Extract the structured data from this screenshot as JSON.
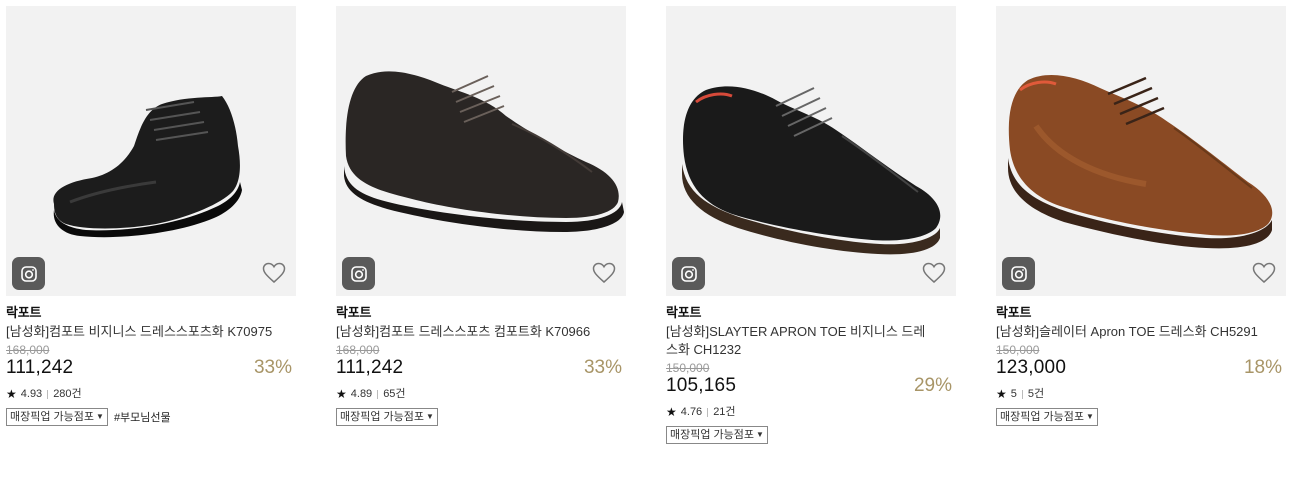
{
  "products": [
    {
      "brand": "락포트",
      "name": "[남성화]컴포트 비지니스 드레스스포츠화 K70975",
      "original_price": "168,000",
      "price": "111,242",
      "discount": "33%",
      "rating": "4.93",
      "reviews": "280건",
      "pickup": "매장픽업 가능점포",
      "hashtag": "#부모님선물",
      "shoe_color": "#1c1c1c",
      "icons": [
        "camera-icon",
        "heart-icon",
        "star-icon",
        "dropdown-arrow-icon"
      ]
    },
    {
      "brand": "락포트",
      "name": "[남성화]컴포트 드레스스포츠 컴포트화 K70966",
      "original_price": "168,000",
      "price": "111,242",
      "discount": "33%",
      "rating": "4.89",
      "reviews": "65건",
      "pickup": "매장픽업 가능점포",
      "shoe_color": "#2a2624",
      "icons": [
        "camera-icon",
        "heart-icon",
        "star-icon",
        "dropdown-arrow-icon"
      ]
    },
    {
      "brand": "락포트",
      "name": "[남성화]SLAYTER APRON TOE 비지니스 드레스화 CH1232",
      "original_price": "150,000",
      "price": "105,165",
      "discount": "29%",
      "rating": "4.76",
      "reviews": "21건",
      "pickup": "매장픽업 가능점포",
      "shoe_color": "#1a1a1a",
      "icons": [
        "camera-icon",
        "heart-icon",
        "star-icon",
        "dropdown-arrow-icon"
      ]
    },
    {
      "brand": "락포트",
      "name": "[남성화]슬레이터 Apron TOE 드레스화 CH5291",
      "original_price": "150,000",
      "price": "123,000",
      "discount": "18%",
      "rating": "5",
      "reviews": "5건",
      "pickup": "매장픽업 가능점포",
      "shoe_color": "#8a4a24",
      "icons": [
        "camera-icon",
        "heart-icon",
        "star-icon",
        "dropdown-arrow-icon"
      ]
    }
  ],
  "colors": {
    "discount": "#a89567",
    "strike": "#999999",
    "thumb_bg": "#f2f2f2",
    "camera_btn": "#5a5a5a"
  }
}
